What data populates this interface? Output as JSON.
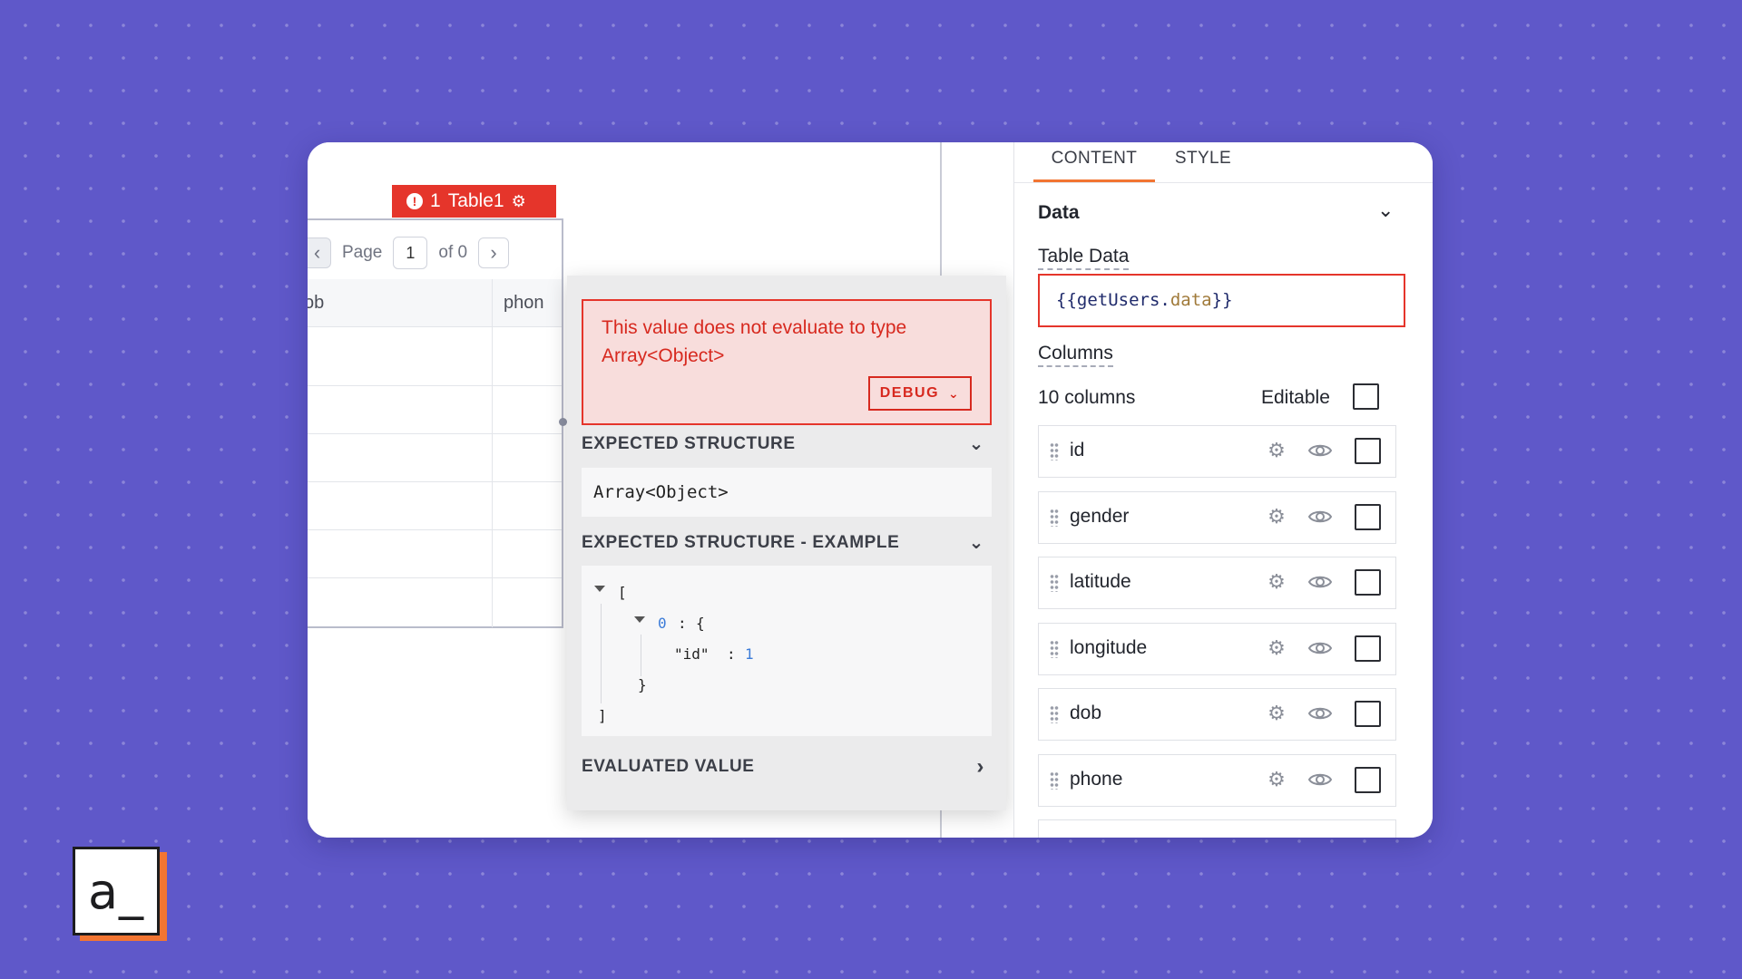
{
  "widget": {
    "error_count": "1",
    "name": "Table1"
  },
  "table": {
    "page_label": "Page",
    "page_number": "1",
    "page_total": "of 0",
    "columns": [
      "ob",
      "phon"
    ]
  },
  "popover": {
    "error_message": "This value does not evaluate to type Array<Object>",
    "debug_label": "DEBUG",
    "expected_structure_title": "EXPECTED STRUCTURE",
    "expected_structure_value": "Array<Object>",
    "example_title": "EXPECTED STRUCTURE - EXAMPLE",
    "example": {
      "open_bracket": "[",
      "index": "0",
      "colon": ":",
      "open_brace": "{",
      "key": "\"id\"",
      "value": "1",
      "close_brace": "}",
      "close_bracket": "]"
    },
    "evaluated_value_title": "EVALUATED VALUE"
  },
  "pane": {
    "tabs": [
      "CONTENT",
      "STYLE"
    ],
    "active_tab": "CONTENT",
    "section_title": "Data",
    "table_data_label": "Table Data",
    "table_data_value": {
      "open": "{{",
      "object": "getUsers",
      "dot": ".",
      "property": "data",
      "close": "}}"
    },
    "columns_label": "Columns",
    "columns_count": "10 columns",
    "editable_label": "Editable",
    "column_items": [
      {
        "name": "id"
      },
      {
        "name": "gender"
      },
      {
        "name": "latitude"
      },
      {
        "name": "longitude"
      },
      {
        "name": "dob"
      },
      {
        "name": "phone"
      }
    ]
  },
  "logo": {
    "text": "a_"
  },
  "colors": {
    "background": "#5f58c9",
    "error_red": "#e5352b",
    "accent_orange": "#f27532"
  },
  "icons": [
    "error-icon",
    "gear-icon",
    "chevron-left-icon",
    "chevron-right-icon",
    "chevron-down-icon",
    "drag-handle-icon",
    "eye-icon"
  ]
}
